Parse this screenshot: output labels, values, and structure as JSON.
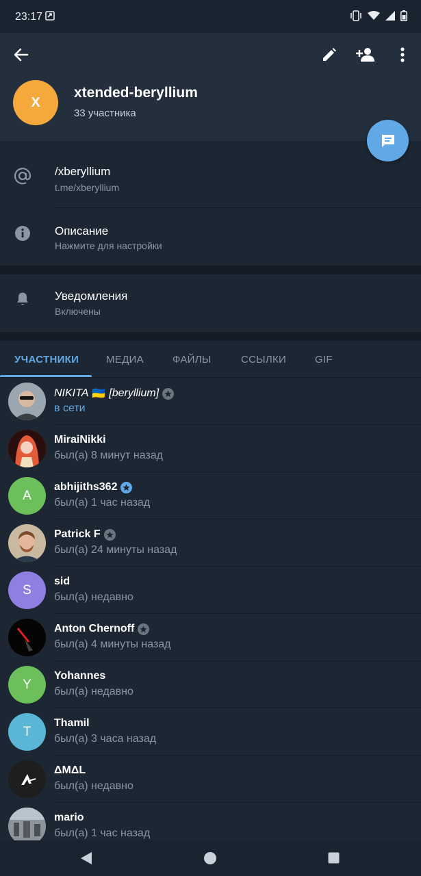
{
  "status_bar": {
    "time": "23:17"
  },
  "header": {
    "avatar_letter": "X",
    "avatar_color": "#f5a93c",
    "title": "xtended-beryllium",
    "subtitle": "33 участника"
  },
  "info": {
    "username": {
      "title": "/xberyllium",
      "sub": "t.me/xberyllium"
    },
    "description": {
      "title": "Описание",
      "sub": "Нажмите для настройки"
    },
    "notifications": {
      "title": "Уведомления",
      "sub": "Включены"
    }
  },
  "tabs": [
    "УЧАСТНИКИ",
    "МЕДИА",
    "ФАЙЛЫ",
    "ССЫЛКИ",
    "GIF"
  ],
  "members": [
    {
      "name": "NIKITA",
      "flag": "🇺🇦",
      "name_suffix": "[beryllium]",
      "status": "в сети",
      "online": true,
      "italic": true,
      "avatar_color": "#7a8a99",
      "letter": "",
      "badge": "gray"
    },
    {
      "name": "MiraiNikki",
      "status": "был(а) 8 минут назад",
      "avatar_color": "#8a1c1c",
      "letter": ""
    },
    {
      "name": "abhijiths362",
      "status": "был(а) 1 час назад",
      "avatar_color": "#6cbf5a",
      "letter": "A",
      "badge": "blue"
    },
    {
      "name": "Patrick F",
      "status": "был(а) 24 минуты назад",
      "avatar_color": "#9a7b62",
      "letter": "",
      "badge": "gray"
    },
    {
      "name": "sid",
      "status": "был(а) недавно",
      "avatar_color": "#8f7fe0",
      "letter": "S"
    },
    {
      "name": "Anton Chernoff",
      "status": "был(а) 4 минуты назад",
      "avatar_color": "#0d0d0d",
      "letter": "",
      "badge": "gray"
    },
    {
      "name": "Yohannes",
      "status": "был(а) недавно",
      "avatar_color": "#6cbf5a",
      "letter": "Y"
    },
    {
      "name": "Thamil",
      "status": "был(а) 3 часа назад",
      "avatar_color": "#5ab6d4",
      "letter": "T"
    },
    {
      "name": "ΔMΔL",
      "status": "был(а) недавно",
      "avatar_color": "#1e1e1e",
      "letter": ""
    },
    {
      "name": "mario",
      "status": "был(а) 1 час назад",
      "avatar_color": "#6f7780",
      "letter": ""
    }
  ]
}
